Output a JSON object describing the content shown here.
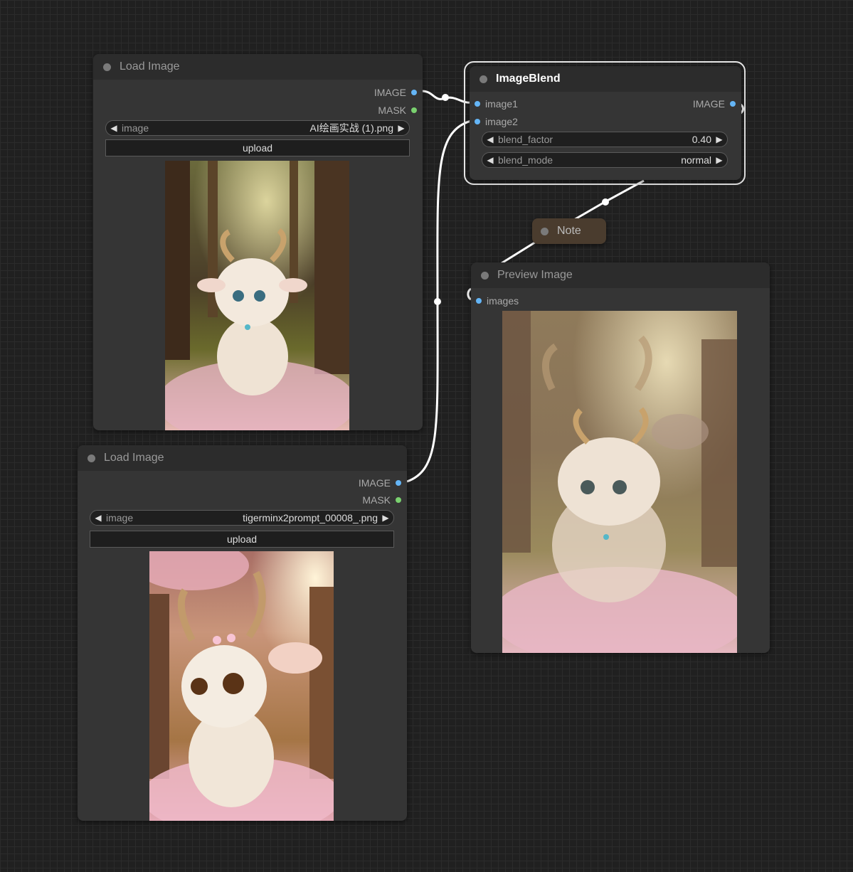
{
  "nodes": {
    "load1": {
      "title": "Load Image",
      "out_image": "IMAGE",
      "out_mask": "MASK",
      "widget_label": "image",
      "widget_value": "AI绘画实战 (1).png",
      "upload": "upload",
      "preview_alt": "fluffy horned creature in forest with flowers"
    },
    "load2": {
      "title": "Load Image",
      "out_image": "IMAGE",
      "out_mask": "MASK",
      "widget_label": "image",
      "widget_value": "tigerminx2prompt_00008_.png",
      "upload": "upload",
      "preview_alt": "horned creature with large eyes among pink blossoms"
    },
    "blend": {
      "title": "ImageBlend",
      "in1": "image1",
      "in2": "image2",
      "out_image": "IMAGE",
      "factor_label": "blend_factor",
      "factor_value": "0.40",
      "mode_label": "blend_mode",
      "mode_value": "normal"
    },
    "note": {
      "title": "Note"
    },
    "preview": {
      "title": "Preview Image",
      "in": "images",
      "preview_alt": "blended image of two horned creatures"
    }
  },
  "colors": {
    "canvas": "#202020",
    "node_body": "#353535",
    "node_title": "#2c2c2c",
    "socket_image": "#64b5f6",
    "socket_mask": "#7ad16f",
    "link": "#ffffff",
    "note_body": "#4a3c2e"
  },
  "icons": {
    "left_arrow": "◀",
    "right_arrow": "▶"
  }
}
